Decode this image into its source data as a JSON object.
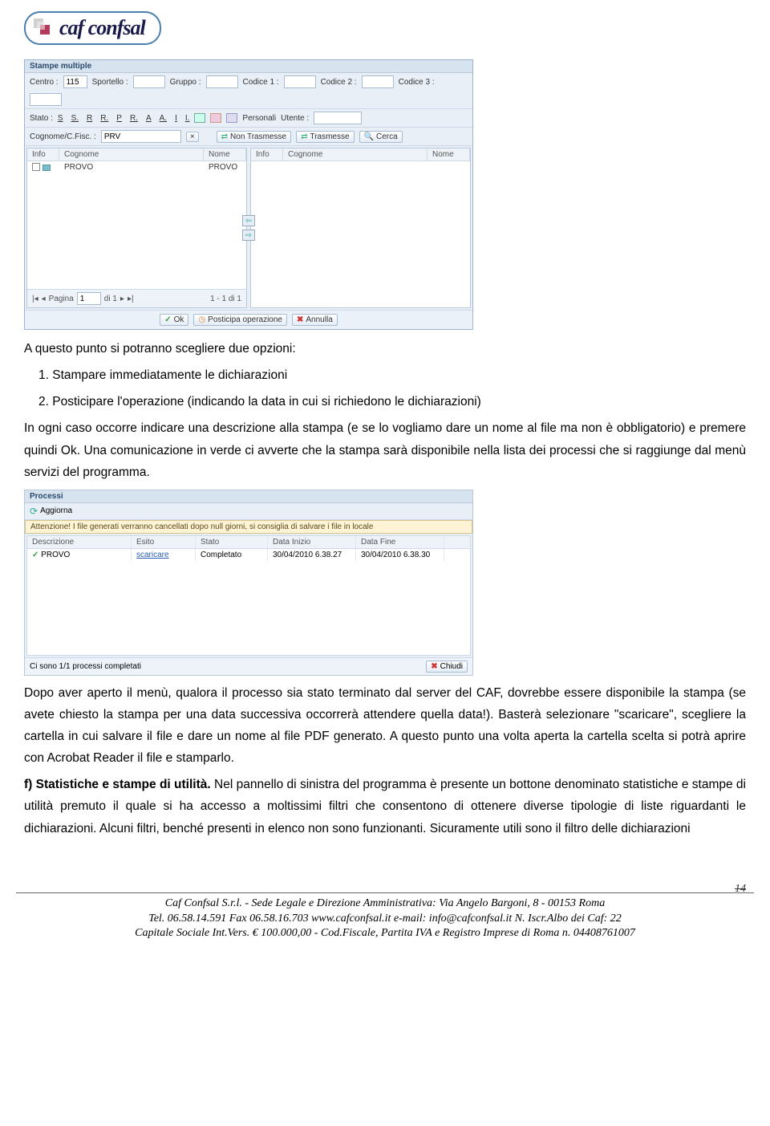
{
  "logo": {
    "text": "caf confsal"
  },
  "stampe": {
    "title": "Stampe multiple",
    "row1": {
      "centro_lbl": "Centro :",
      "centro_val": "115",
      "sportello_lbl": "Sportello :",
      "sportello_val": "",
      "gruppo_lbl": "Gruppo :",
      "gruppo_val": "",
      "cod1_lbl": "Codice 1 :",
      "cod1_val": "",
      "cod2_lbl": "Codice 2 :",
      "cod2_val": "",
      "cod3_lbl": "Codice 3 :",
      "cod3_val": ""
    },
    "row2": {
      "stato_lbl": "Stato :",
      "letters": [
        "S",
        "S.",
        "R",
        "R.",
        "P",
        "R.",
        "A",
        "A.",
        "I",
        "I."
      ],
      "personali_lbl": "Personali",
      "utente_lbl": "Utente :",
      "utente_val": ""
    },
    "row3": {
      "cognome_lbl": "Cognome/C.Fisc. :",
      "cognome_val": "PRV",
      "non_trasmesse": "Non Trasmesse",
      "trasmesse": "Trasmesse",
      "cerca": "Cerca"
    },
    "cols": {
      "info": "Info",
      "cognome": "Cognome",
      "nome": "Nome"
    },
    "left_rows": [
      {
        "cognome": "PROVO",
        "nome": "PROVO"
      }
    ],
    "pager": {
      "pagina": "Pagina",
      "num": "1",
      "di": "di 1",
      "range": "1 - 1 di 1"
    },
    "buttons": {
      "ok": "Ok",
      "posticipa": "Posticipa operazione",
      "annulla": "Annulla"
    }
  },
  "text": {
    "p1": "A questo punto si potranno scegliere due opzioni:",
    "li1": "1.  Stampare  immediatamente le dichiarazioni",
    "li2a": "2.  Posticipare l'operazione (indicando la data in cui si richiedono le dichiarazioni)",
    "p2": "In ogni caso occorre indicare una descrizione alla stampa (e se lo vogliamo dare un nome al file ma non è obbligatorio) e premere quindi Ok. Una comunicazione in verde ci avverte che la stampa sarà disponibile nella lista dei processi che si raggiunge dal menù servizi del programma.",
    "p3": "Dopo aver aperto il menù, qualora il processo sia stato terminato dal  server del CAF, dovrebbe essere disponibile la stampa (se avete chiesto la stampa per una data successiva occorrerà attendere quella data!). Basterà selezionare \"scaricare\", scegliere la cartella in cui salvare il file e dare un nome al file PDF generato. A questo punto una volta aperta la cartella scelta si potrà aprire con Acrobat Reader il file e stamparlo.",
    "p4a": "f) Statistiche e stampe di utilità.",
    "p4b": " Nel pannello di  sinistra del programma è presente un bottone denominato statistiche e stampe di utilità premuto il quale si ha accesso a moltissimi filtri che consentono di ottenere diverse tipologie di liste riguardanti le dichiarazioni. Alcuni filtri, benché presenti in elenco non sono funzionanti. Sicuramente utili sono il filtro delle dichiarazioni"
  },
  "processi": {
    "title": "Processi",
    "aggiorna": "Aggiorna",
    "warn": "Attenzione! I file generati verranno cancellati dopo null giorni, si consiglia di salvare i file in locale",
    "cols": {
      "descr": "Descrizione",
      "esito": "Esito",
      "stato": "Stato",
      "inizio": "Data Inizio",
      "fine": "Data Fine"
    },
    "rows": [
      {
        "descr": "PROVO",
        "esito": "scaricare",
        "stato": "Completato",
        "inizio": "30/04/2010 6.38.27",
        "fine": "30/04/2010 6.38.30"
      }
    ],
    "footer_status": "Ci sono 1/1 processi completati",
    "chiudi": "Chiudi"
  },
  "footer": {
    "l1": "Caf Confsal S.r.l. - Sede Legale e Direzione Amministrativa: Via Angelo Bargoni, 8 - 00153 Roma",
    "l2": "Tel. 06.58.14.591   Fax 06.58.16.703  www.cafconfsal.it   e-mail: info@cafconfsal.it   N. Iscr.Albo dei Caf: 22",
    "l3": "Capitale Sociale Int.Vers. € 100.000,00 - Cod.Fiscale, Partita IVA e Registro Imprese di Roma n. 04408761007",
    "page": "14"
  }
}
